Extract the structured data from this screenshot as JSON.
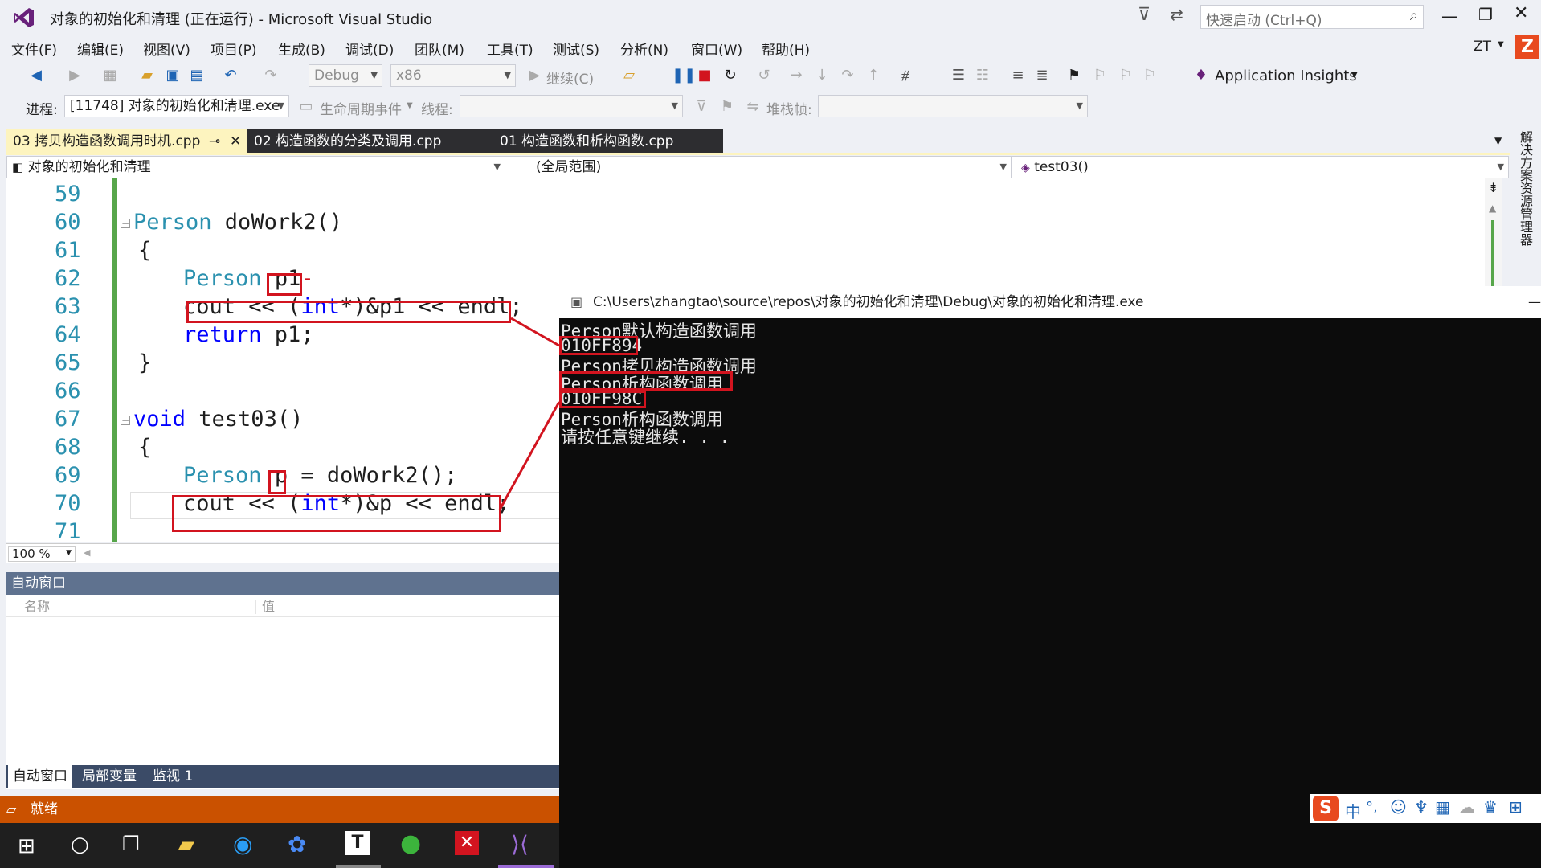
{
  "window": {
    "title": "对象的初始化和清理 (正在运行) - Microsoft Visual Studio",
    "quick_launch_placeholder": "快速启动 (Ctrl+Q)",
    "user_initials": "ZT"
  },
  "menu": [
    "文件(F)",
    "编辑(E)",
    "视图(V)",
    "项目(P)",
    "生成(B)",
    "调试(D)",
    "团队(M)",
    "工具(T)",
    "测试(S)",
    "分析(N)",
    "窗口(W)",
    "帮助(H)"
  ],
  "toolbar": {
    "config": "Debug",
    "platform": "x86",
    "continue_label": "继续(C)",
    "app_insights": "Application Insights"
  },
  "debugbar": {
    "process_label": "进程:",
    "process_value": "[11748] 对象的初始化和清理.exe",
    "lifecycle_label": "生命周期事件",
    "thread_label": "线程:",
    "stackframe_label": "堆栈帧:"
  },
  "tabs": [
    {
      "label": "03 拷贝构造函数调用时机.cpp",
      "active": true
    },
    {
      "label": "02 构造函数的分类及调用.cpp",
      "active": false
    },
    {
      "label": "01 构造函数和析构函数.cpp",
      "active": false
    }
  ],
  "navbar": {
    "project": "对象的初始化和清理",
    "scope": "(全局范围)",
    "member": "test03()"
  },
  "code": {
    "lines": [
      {
        "n": "59"
      },
      {
        "n": "60"
      },
      {
        "n": "61"
      },
      {
        "n": "62"
      },
      {
        "n": "63"
      },
      {
        "n": "64"
      },
      {
        "n": "65"
      },
      {
        "n": "66"
      },
      {
        "n": "67"
      },
      {
        "n": "68"
      },
      {
        "n": "69"
      },
      {
        "n": "70"
      },
      {
        "n": "71"
      }
    ],
    "t_person": "Person",
    "t_dowork2": " doWork2()",
    "t_brace_open": "{",
    "t_brace_close": "}",
    "t_p1": "p1",
    "t_cout": "cout << ",
    "t_int": "int",
    "t_cast_rest": "*)&p1 << endl;",
    "t_return": "return",
    "t_return_rest": " p1;",
    "t_void": "void",
    "t_test03": " test03()",
    "t_p": "p",
    "t_assign": " = doWork2();",
    "t_cast_rest2": "*)&p << endl;",
    "t_paren": "("
  },
  "zoom": "100 %",
  "auto_window": {
    "title": "自动窗口",
    "col_name": "名称",
    "col_value": "值",
    "tabs": [
      "自动窗口",
      "局部变量",
      "监视 1"
    ]
  },
  "status": "就绪",
  "console": {
    "title": "C:\\Users\\zhangtao\\source\\repos\\对象的初始化和清理\\Debug\\对象的初始化和清理.exe",
    "lines": [
      "Person默认构造函数调用",
      "010FF894",
      "Person拷贝构造函数调用",
      "Person析构函数调用",
      "010FF98C",
      "Person析构函数调用",
      "请按任意键继续. . ."
    ]
  },
  "right_panel": "解决方案资源管理器",
  "ime": "中"
}
